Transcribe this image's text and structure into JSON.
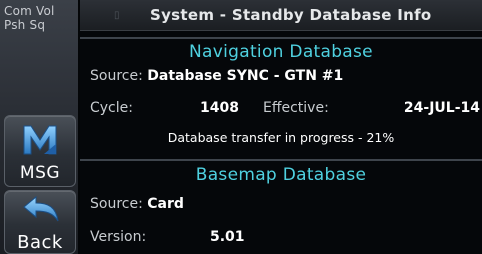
{
  "left_panel": {
    "com_vol_line1": "Com Vol",
    "com_vol_line2": "Psh Sq",
    "msg_label": "MSG",
    "back_label": "Back"
  },
  "title_bar": {
    "title": "System - Standby Database Info"
  },
  "navigation_database": {
    "header": "Navigation Database",
    "source_label": "Source:",
    "source_value": "Database SYNC - GTN #1",
    "cycle_label": "Cycle:",
    "cycle_value": "1408",
    "effective_label": "Effective:",
    "effective_value": "24-JUL-14",
    "progress_text": "Database transfer in progress - 21%",
    "progress_percent": 21
  },
  "basemap_database": {
    "header": "Basemap Database",
    "source_label": "Source:",
    "source_value": "Card",
    "version_label": "Version:",
    "version_value": "5.01"
  },
  "colors": {
    "header_cyan": "#4fd1e0",
    "msg_icon_blue": "#4aa3df",
    "back_icon_blue": "#3f93d6"
  },
  "icons": {
    "msg": "message-m-icon",
    "back": "back-arrow-icon"
  }
}
